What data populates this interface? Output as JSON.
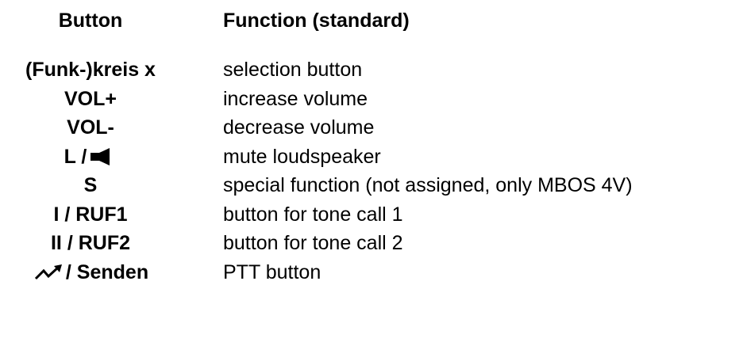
{
  "header": {
    "button_col": "Button",
    "function_col": "Function (standard)"
  },
  "rows": [
    {
      "button": "(Funk-)kreis x",
      "function": "selection button"
    },
    {
      "button": "VOL+",
      "function": "increase volume"
    },
    {
      "button": "VOL-",
      "function": "decrease volume"
    },
    {
      "button_prefix": "L /",
      "button_icon": "loudspeaker-icon",
      "function": "mute loudspeaker"
    },
    {
      "button": "S",
      "function": "special function (not assigned, only MBOS 4V)"
    },
    {
      "button": "I / RUF1",
      "function": "button for tone call 1"
    },
    {
      "button": "II / RUF2",
      "function": "button for tone call 2"
    },
    {
      "button_icon": "transmit-icon",
      "button_suffix": "/ Senden",
      "function": "PTT button"
    }
  ]
}
